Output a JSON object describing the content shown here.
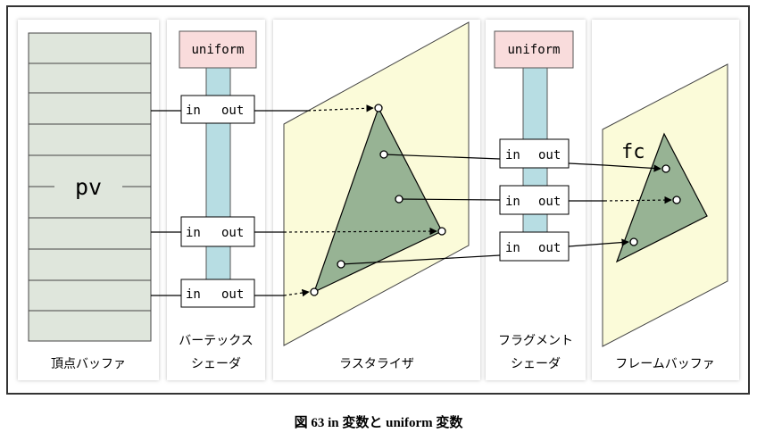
{
  "columns": {
    "vertex_buffer": "頂点バッファ",
    "vertex_shader": [
      "バーテックス",
      "シェーダ"
    ],
    "rasterizer": "ラスタライザ",
    "fragment_shader": [
      "フラグメント",
      "シェーダ"
    ],
    "frame_buffer": "フレームバッファ"
  },
  "buffer_label": "pv",
  "uniform_label": "uniform",
  "port_in": "in",
  "port_out": "out",
  "fc_label": "fc",
  "caption": "図 63 in 変数と uniform 変数",
  "colors": {
    "frame_border": "#333333",
    "buffer_fill": "#dfe6dc",
    "uniform_fill": "#f9dcdc",
    "pipe_fill": "#b7dde3",
    "plane_fill": "#fbfbd9",
    "triangle_fill": "#97b394"
  }
}
